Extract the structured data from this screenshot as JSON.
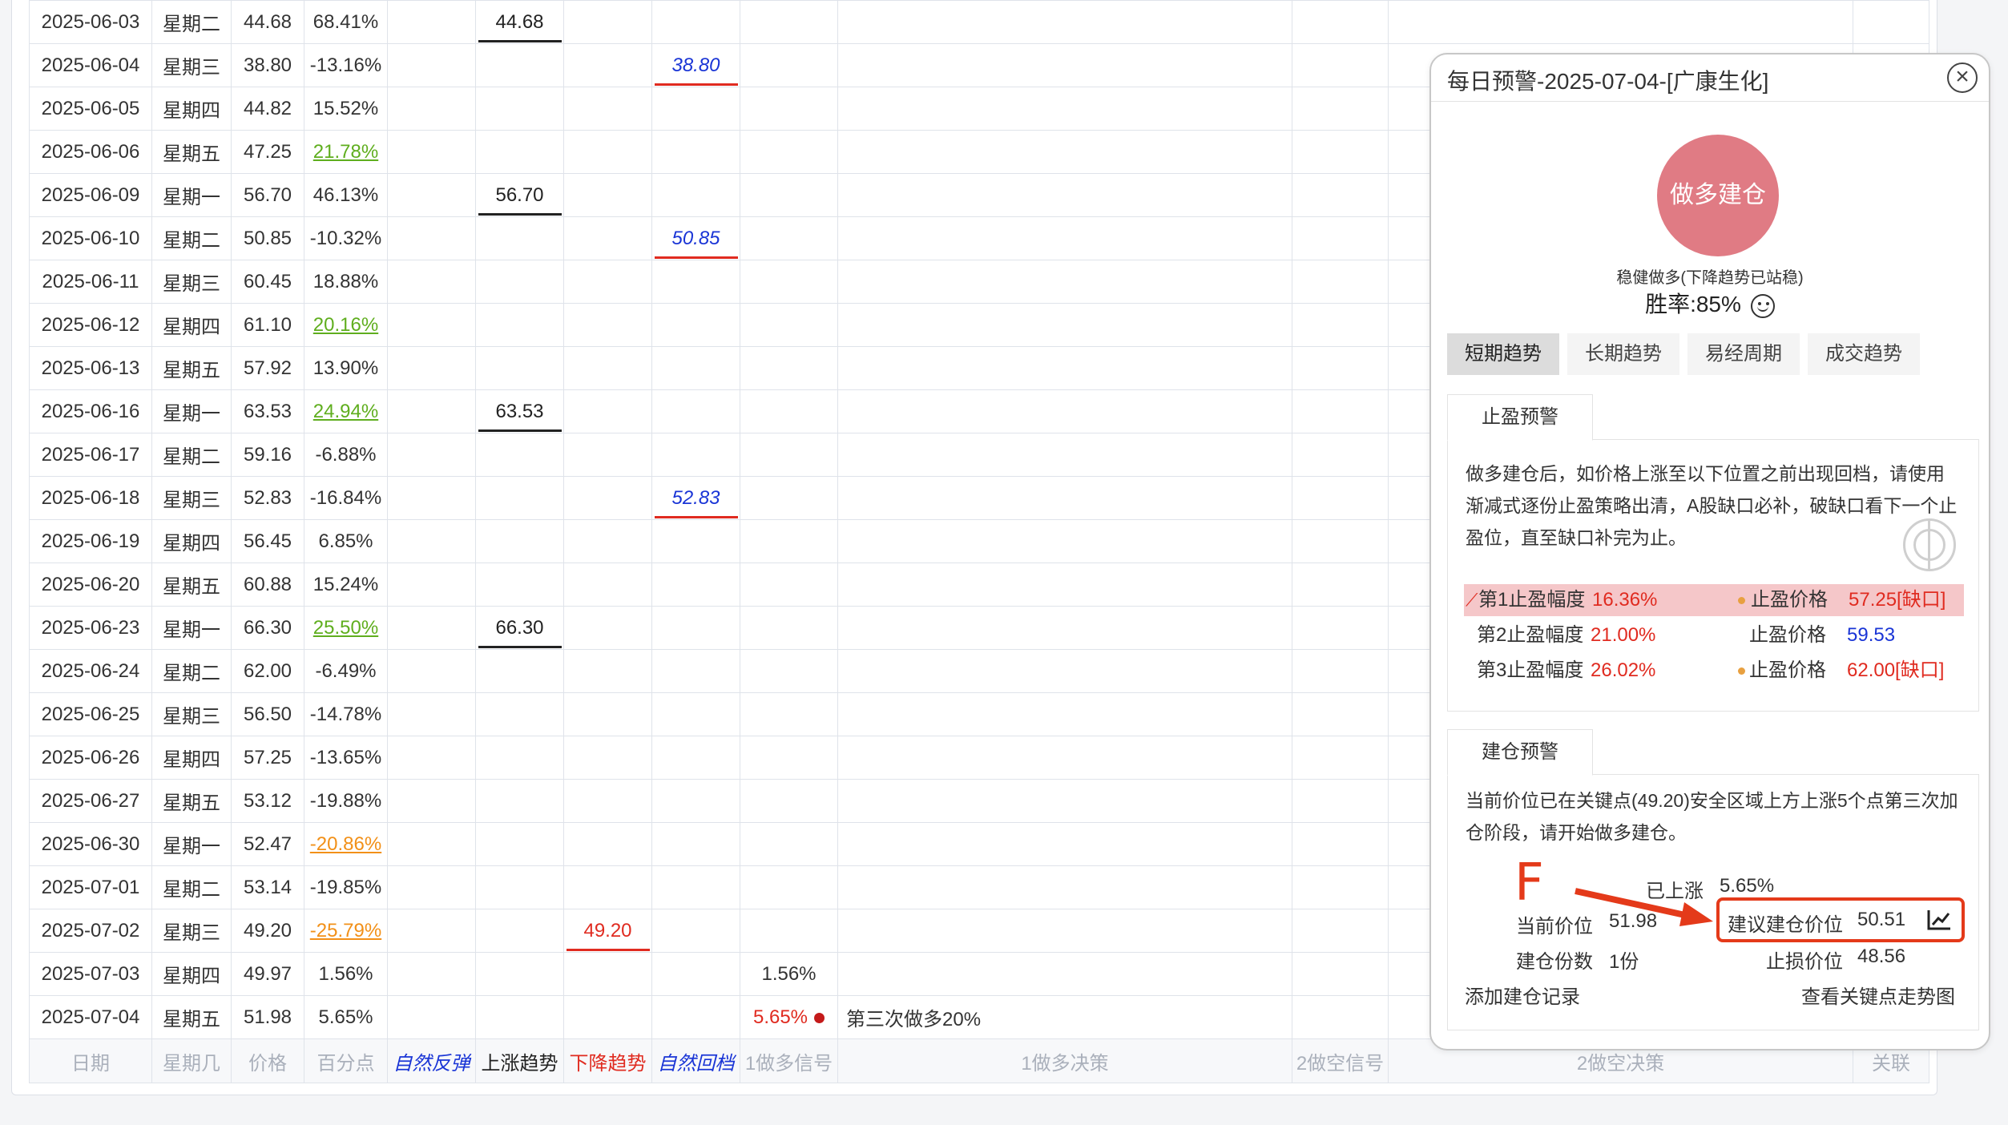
{
  "rows": [
    {
      "date": "2025-06-03",
      "weekday": "星期二",
      "price": "44.68",
      "pct": "68.41%",
      "pct_style": "plain",
      "up_trend": "44.68",
      "down_trend": "",
      "pullback": "",
      "long_signal": "",
      "long_decision": ""
    },
    {
      "date": "2025-06-04",
      "weekday": "星期三",
      "price": "38.80",
      "pct": "-13.16%",
      "pct_style": "plain",
      "up_trend": "",
      "down_trend": "",
      "pullback": "38.80",
      "long_signal": "",
      "long_decision": ""
    },
    {
      "date": "2025-06-05",
      "weekday": "星期四",
      "price": "44.82",
      "pct": "15.52%",
      "pct_style": "plain",
      "up_trend": "",
      "down_trend": "",
      "pullback": "",
      "long_signal": "",
      "long_decision": ""
    },
    {
      "date": "2025-06-06",
      "weekday": "星期五",
      "price": "47.25",
      "pct": "21.78%",
      "pct_style": "green",
      "up_trend": "",
      "down_trend": "",
      "pullback": "",
      "long_signal": "",
      "long_decision": ""
    },
    {
      "date": "2025-06-09",
      "weekday": "星期一",
      "price": "56.70",
      "pct": "46.13%",
      "pct_style": "plain",
      "up_trend": "56.70",
      "down_trend": "",
      "pullback": "",
      "long_signal": "",
      "long_decision": ""
    },
    {
      "date": "2025-06-10",
      "weekday": "星期二",
      "price": "50.85",
      "pct": "-10.32%",
      "pct_style": "plain",
      "up_trend": "",
      "down_trend": "",
      "pullback": "50.85",
      "long_signal": "",
      "long_decision": ""
    },
    {
      "date": "2025-06-11",
      "weekday": "星期三",
      "price": "60.45",
      "pct": "18.88%",
      "pct_style": "plain",
      "up_trend": "",
      "down_trend": "",
      "pullback": "",
      "long_signal": "",
      "long_decision": ""
    },
    {
      "date": "2025-06-12",
      "weekday": "星期四",
      "price": "61.10",
      "pct": "20.16%",
      "pct_style": "green",
      "up_trend": "",
      "down_trend": "",
      "pullback": "",
      "long_signal": "",
      "long_decision": ""
    },
    {
      "date": "2025-06-13",
      "weekday": "星期五",
      "price": "57.92",
      "pct": "13.90%",
      "pct_style": "plain",
      "up_trend": "",
      "down_trend": "",
      "pullback": "",
      "long_signal": "",
      "long_decision": ""
    },
    {
      "date": "2025-06-16",
      "weekday": "星期一",
      "price": "63.53",
      "pct": "24.94%",
      "pct_style": "green",
      "up_trend": "63.53",
      "down_trend": "",
      "pullback": "",
      "long_signal": "",
      "long_decision": ""
    },
    {
      "date": "2025-06-17",
      "weekday": "星期二",
      "price": "59.16",
      "pct": "-6.88%",
      "pct_style": "plain",
      "up_trend": "",
      "down_trend": "",
      "pullback": "",
      "long_signal": "",
      "long_decision": ""
    },
    {
      "date": "2025-06-18",
      "weekday": "星期三",
      "price": "52.83",
      "pct": "-16.84%",
      "pct_style": "plain",
      "up_trend": "",
      "down_trend": "",
      "pullback": "52.83",
      "long_signal": "",
      "long_decision": ""
    },
    {
      "date": "2025-06-19",
      "weekday": "星期四",
      "price": "56.45",
      "pct": "6.85%",
      "pct_style": "plain",
      "up_trend": "",
      "down_trend": "",
      "pullback": "",
      "long_signal": "",
      "long_decision": ""
    },
    {
      "date": "2025-06-20",
      "weekday": "星期五",
      "price": "60.88",
      "pct": "15.24%",
      "pct_style": "plain",
      "up_trend": "",
      "down_trend": "",
      "pullback": "",
      "long_signal": "",
      "long_decision": ""
    },
    {
      "date": "2025-06-23",
      "weekday": "星期一",
      "price": "66.30",
      "pct": "25.50%",
      "pct_style": "green",
      "up_trend": "66.30",
      "down_trend": "",
      "pullback": "",
      "long_signal": "",
      "long_decision": ""
    },
    {
      "date": "2025-06-24",
      "weekday": "星期二",
      "price": "62.00",
      "pct": "-6.49%",
      "pct_style": "plain",
      "up_trend": "",
      "down_trend": "",
      "pullback": "",
      "long_signal": "",
      "long_decision": ""
    },
    {
      "date": "2025-06-25",
      "weekday": "星期三",
      "price": "56.50",
      "pct": "-14.78%",
      "pct_style": "plain",
      "up_trend": "",
      "down_trend": "",
      "pullback": "",
      "long_signal": "",
      "long_decision": ""
    },
    {
      "date": "2025-06-26",
      "weekday": "星期四",
      "price": "57.25",
      "pct": "-13.65%",
      "pct_style": "plain",
      "up_trend": "",
      "down_trend": "",
      "pullback": "",
      "long_signal": "",
      "long_decision": ""
    },
    {
      "date": "2025-06-27",
      "weekday": "星期五",
      "price": "53.12",
      "pct": "-19.88%",
      "pct_style": "plain",
      "up_trend": "",
      "down_trend": "",
      "pullback": "",
      "long_signal": "",
      "long_decision": ""
    },
    {
      "date": "2025-06-30",
      "weekday": "星期一",
      "price": "52.47",
      "pct": "-20.86%",
      "pct_style": "orange",
      "up_trend": "",
      "down_trend": "",
      "pullback": "",
      "long_signal": "",
      "long_decision": ""
    },
    {
      "date": "2025-07-01",
      "weekday": "星期二",
      "price": "53.14",
      "pct": "-19.85%",
      "pct_style": "plain",
      "up_trend": "",
      "down_trend": "",
      "pullback": "",
      "long_signal": "",
      "long_decision": ""
    },
    {
      "date": "2025-07-02",
      "weekday": "星期三",
      "price": "49.20",
      "pct": "-25.79%",
      "pct_style": "orange",
      "up_trend": "",
      "down_trend": "49.20",
      "pullback": "",
      "long_signal": "",
      "long_decision": ""
    },
    {
      "date": "2025-07-03",
      "weekday": "星期四",
      "price": "49.97",
      "pct": "1.56%",
      "pct_style": "plain",
      "up_trend": "",
      "down_trend": "",
      "pullback": "",
      "long_signal": "1.56%",
      "long_signal_style": "gray",
      "long_decision": ""
    },
    {
      "date": "2025-07-04",
      "weekday": "星期五",
      "price": "51.98",
      "pct": "5.65%",
      "pct_style": "plain",
      "up_trend": "",
      "down_trend": "",
      "pullback": "",
      "long_signal": "5.65%",
      "long_signal_style": "red",
      "long_decision": "第三次做多20%"
    }
  ],
  "footer": [
    "日期",
    "星期几",
    "价格",
    "百分点",
    "自然反弹",
    "上涨趋势",
    "下降趋势",
    "自然回档",
    "1做多信号",
    "1做多决策",
    "2做空信号",
    "2做空决策",
    "关联"
  ],
  "panel": {
    "title": "每日预警-2025-07-04-[广康生化]",
    "action_label": "做多建仓",
    "subtitle": "稳健做多(下降趋势已站稳)",
    "win_rate": "胜率:85%",
    "tabs": [
      "短期趋势",
      "长期趋势",
      "易经周期",
      "成交趋势"
    ],
    "take_profit": {
      "tab": "止盈预警",
      "text": "做多建仓后，如价格上涨至以下位置之前出现回档，请使用渐减式逐份止盈策略出清，A股缺口必补，破缺口看下一个止盈位，直至缺口补完为止。",
      "levels": [
        {
          "label": "第1止盈幅度",
          "pct": "16.36%",
          "price_label": "止盈价格",
          "price": "57.25[缺口]",
          "gap": true,
          "price_color": "red"
        },
        {
          "label": "第2止盈幅度",
          "pct": "21.00%",
          "price_label": "止盈价格",
          "price": "59.53",
          "gap": false,
          "price_color": "blue"
        },
        {
          "label": "第3止盈幅度",
          "pct": "26.02%",
          "price_label": "止盈价格",
          "price": "62.00[缺口]",
          "gap": true,
          "price_color": "red"
        }
      ]
    },
    "build": {
      "tab": "建仓预警",
      "text": "当前价位已在关键点(49.20)安全区域上方上涨5个点第三次加仓阶段，请开始做多建仓。",
      "risen_label": "已上涨",
      "risen_value": "5.65%",
      "current_label": "当前价位",
      "current_value": "51.98",
      "suggest_label": "建议建仓价位",
      "suggest_value": "50.51",
      "shares_label": "建仓份数",
      "shares_value": "1份",
      "stop_label": "止损价位",
      "stop_value": "48.56",
      "add_record": "添加建仓记录",
      "view_chart": "查看关键点走势图"
    }
  },
  "annotation": {
    "letter": "F",
    "color": "#e43a1a"
  }
}
